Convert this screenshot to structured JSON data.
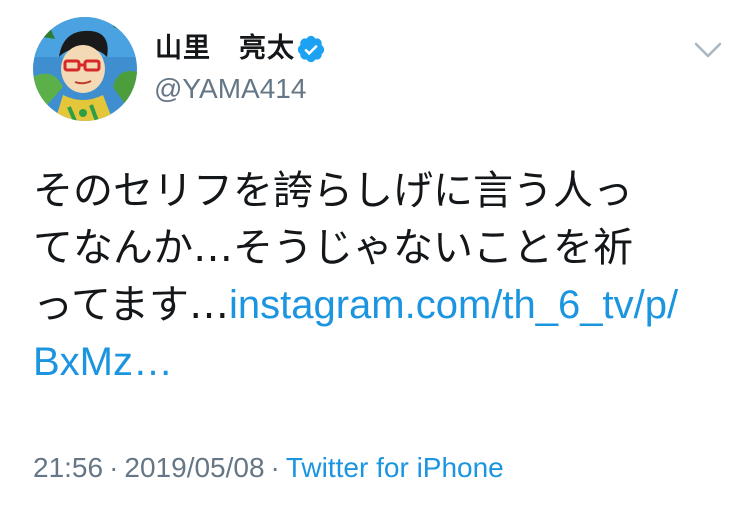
{
  "user": {
    "display_name": "山里　亮太",
    "handle": "@YAMA414",
    "verified": true,
    "avatar_icon": "cartoon-portrait-avatar"
  },
  "tweet": {
    "line1": "そのセリフを誇らしげに言う人っ",
    "line2": "てなんか…そうじゃないことを祈",
    "line3_text": "ってます…",
    "link_part1": "instagram.com/th_6_tv/p/",
    "link_part2": "BxMz…"
  },
  "meta": {
    "time": "21:56",
    "separator1": "·",
    "date": "2019/05/08",
    "separator2": "·",
    "source": "Twitter for iPhone"
  },
  "icons": {
    "verified": "verified-badge-icon",
    "menu": "chevron-down-icon"
  },
  "colors": {
    "text": "#14171a",
    "secondary": "#657786",
    "link": "#1b95e0",
    "verified": "#1da1f2"
  }
}
